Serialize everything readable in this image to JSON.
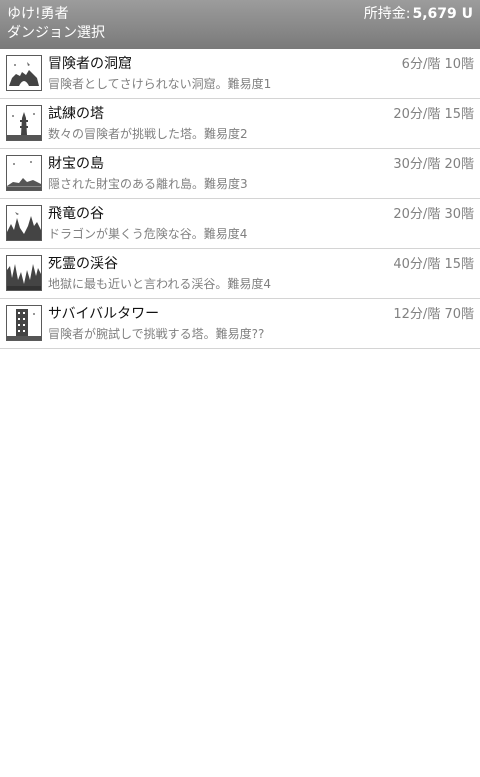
{
  "header": {
    "app_title": "ゆけ!勇者",
    "screen_title": "ダンジョン選択",
    "money_label": "所持金:",
    "money_value": "5,679 U",
    "background": "#8a8a8a"
  },
  "dungeons": [
    {
      "name": "冒険者の洞窟",
      "description": "冒険者としてさけられない洞窟。難易度1",
      "stat": "6分/階 10階",
      "icon": "cave-icon"
    },
    {
      "name": "試練の塔",
      "description": "数々の冒険者が挑戦した塔。難易度2",
      "stat": "20分/階 15階",
      "icon": "tower-icon"
    },
    {
      "name": "財宝の島",
      "description": "隠された財宝のある離れ島。難易度3",
      "stat": "30分/階 20階",
      "icon": "island-icon"
    },
    {
      "name": "飛竜の谷",
      "description": "ドラゴンが巣くう危険な谷。難易度4",
      "stat": "20分/階 30階",
      "icon": "dragon-valley-icon"
    },
    {
      "name": "死霊の渓谷",
      "description": "地獄に最も近いと言われる渓谷。難易度4",
      "stat": "40分/階 15階",
      "icon": "ghost-canyon-icon"
    },
    {
      "name": "サバイバルタワー",
      "description": "冒険者が腕試しで挑戦する塔。難易度??",
      "stat": "12分/階 70階",
      "icon": "survival-tower-icon"
    }
  ]
}
